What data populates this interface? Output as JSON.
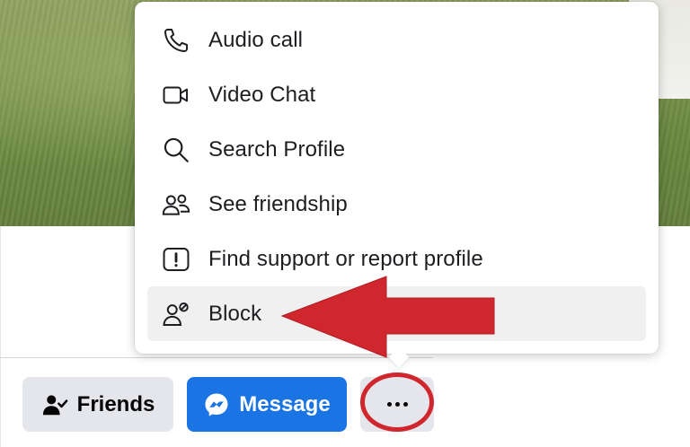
{
  "menu": {
    "items": [
      {
        "label": "Audio call",
        "icon": "phone-icon"
      },
      {
        "label": "Video Chat",
        "icon": "video-camera-icon"
      },
      {
        "label": "Search Profile",
        "icon": "search-icon"
      },
      {
        "label": "See friendship",
        "icon": "friends-icon"
      },
      {
        "label": "Find support or report profile",
        "icon": "report-icon"
      },
      {
        "label": "Block",
        "icon": "block-user-icon"
      }
    ],
    "highlighted_item": "Block"
  },
  "actions": {
    "friends_label": "Friends",
    "message_label": "Message",
    "more_icon": "more-dots-icon"
  },
  "annotations": {
    "arrow_color": "#d0262e",
    "circle_color": "#d0262e"
  },
  "colors": {
    "message_button": "#1b74e4",
    "secondary_button": "#e4e6eb",
    "highlight_row": "#f0f0f0"
  }
}
